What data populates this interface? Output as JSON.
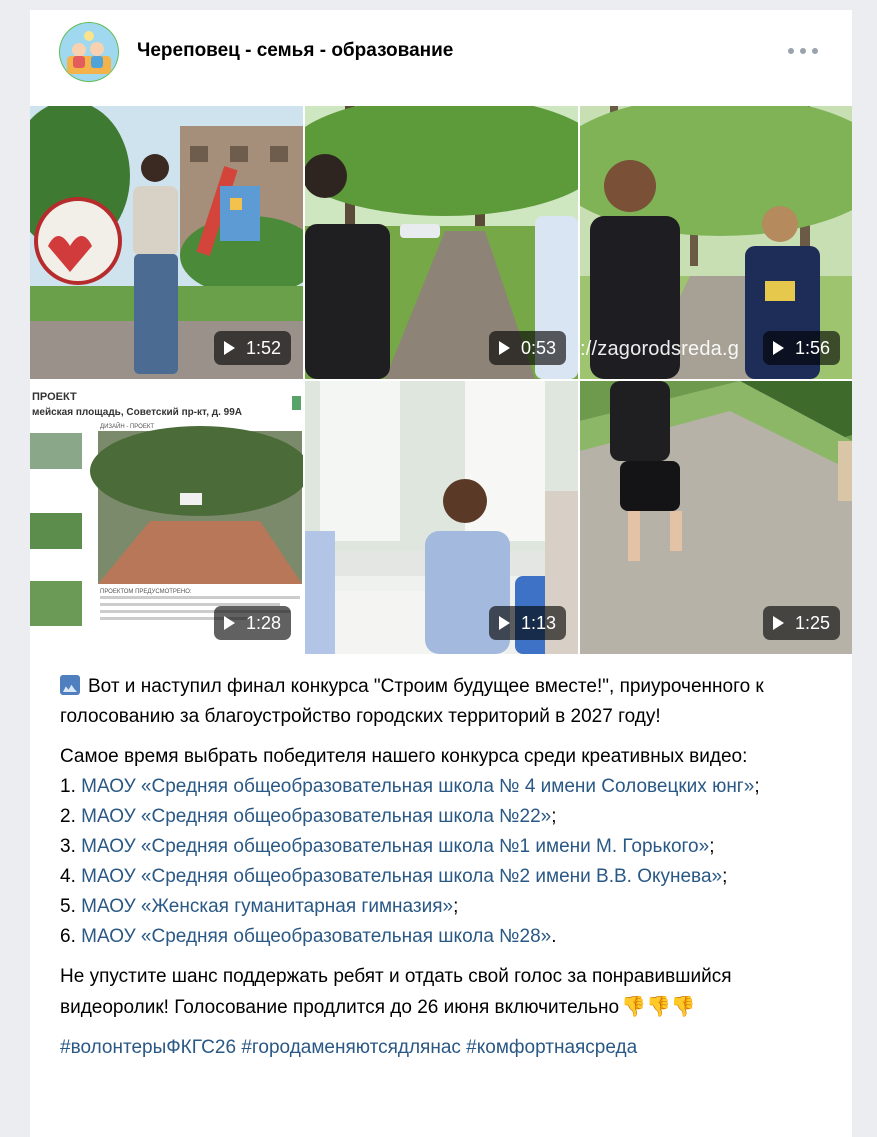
{
  "post": {
    "community_name": "Череповец - семья - образование",
    "more_icon": "more-horizontal-icon"
  },
  "videos": [
    {
      "duration": "1:52"
    },
    {
      "duration": "0:53"
    },
    {
      "duration": "1:56",
      "watermark": "://zagorodsreda.g"
    },
    {
      "duration": "1:28",
      "doc_title": "ПРОЕКТ",
      "doc_address": "мейская площадь, Советский пр-кт, д. 99А",
      "doc_label_1": "ДИЗАЙН - ПРОЕКТ",
      "doc_label_2": "ПРОЕКТОМ ПРЕДУСМОТРЕНО:"
    },
    {
      "duration": "1:13"
    },
    {
      "duration": "1:25"
    }
  ],
  "text": {
    "intro": "Вот и наступил финал конкурса \"Строим будущее вместе!\", приуроченного к голосованию за благоустройство городских территорий в 2027 году!",
    "lead": "Самое время выбрать победителя нашего конкурса среди креативных видео:",
    "list": [
      {
        "num": "1.",
        "link": "МАОУ «Средняя общеобразовательная школа № 4 имени Соловецких юнг»",
        "tail": ";"
      },
      {
        "num": "2.",
        "link": "МАОУ «Средняя общеобразовательная школа №22»",
        "tail": ";"
      },
      {
        "num": "3.",
        "link": "МАОУ «Средняя общеобразовательная школа №1 имени М. Горького»",
        "tail": ";"
      },
      {
        "num": "4.",
        "link": "МАОУ «Средняя общеобразовательная школа №2 имени В.В. Окунева»",
        "tail": ";"
      },
      {
        "num": "5.",
        "link": "МАОУ «Женская гуманитарная гимназия»",
        "tail": ";"
      },
      {
        "num": "6.",
        "link": "МАОУ «Средняя общеобразовательная школа №28»",
        "tail": "."
      }
    ],
    "outro": "Не упустите шанс поддержать ребят и отдать свой голос за понравившийся видеоролик! Голосование продлится до 26 июня включительно",
    "outro_emoji": "👎👎👎",
    "hashtags": [
      "#волонтерыФКГС26",
      "#городаменяютсядлянас",
      "#комфортнаясреда"
    ]
  }
}
